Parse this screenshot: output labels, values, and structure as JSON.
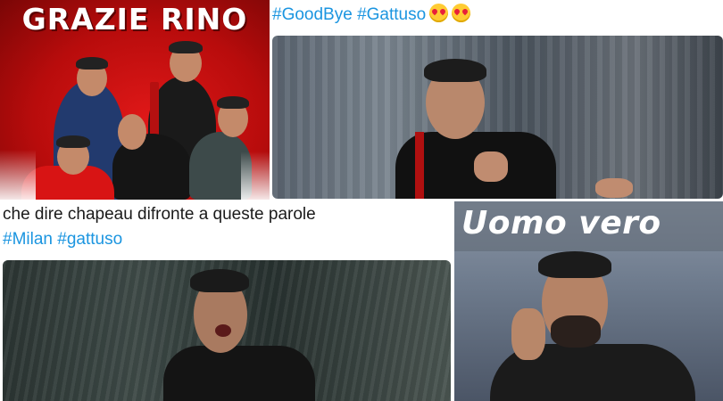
{
  "poster": {
    "title": "GRAZIE RINO"
  },
  "tweet1": {
    "hashtags": "#GoodBye #Gattuso",
    "emoji": [
      "heart-eyes-emoji",
      "heart-eyes-emoji"
    ]
  },
  "tweet2": {
    "text": "che dire chapeau difronte a queste parole",
    "hashtags": "#Milan #gattuso"
  },
  "caption4": {
    "text": "Uomo vero"
  },
  "colors": {
    "hashtag": "#1b95e0",
    "poster_red": "#c41010",
    "text": "#1a1a1a"
  }
}
